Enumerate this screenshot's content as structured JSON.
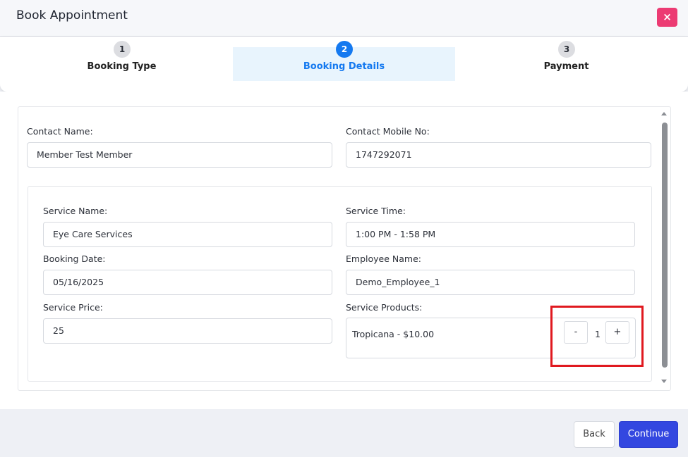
{
  "header": {
    "title": "Book Appointment",
    "close_icon": "×"
  },
  "steps": [
    {
      "number": "1",
      "label": "Booking Type"
    },
    {
      "number": "2",
      "label": "Booking Details"
    },
    {
      "number": "3",
      "label": "Payment"
    }
  ],
  "contact": {
    "name_label": "Contact Name:",
    "name_value": "Member Test Member",
    "mobile_label": "Contact Mobile No:",
    "mobile_value": "1747292071"
  },
  "service": {
    "name_label": "Service Name:",
    "name_value": "Eye Care Services",
    "time_label": "Service Time:",
    "time_value": "1:00 PM - 1:58 PM",
    "date_label": "Booking Date:",
    "date_value": "05/16/2025",
    "employee_label": "Employee Name:",
    "employee_value": "Demo_Employee_1",
    "price_label": "Service Price:",
    "price_value": "25",
    "products_label": "Service Products:",
    "product_name": "Tropicana - $10.00",
    "minus_label": "-",
    "quantity": "1",
    "plus_label": "+"
  },
  "footer": {
    "back_label": "Back",
    "continue_label": "Continue"
  },
  "colors": {
    "accent": "#1479f0",
    "close": "#ec3b73",
    "continue": "#3347e0",
    "highlight": "#e0191f"
  }
}
